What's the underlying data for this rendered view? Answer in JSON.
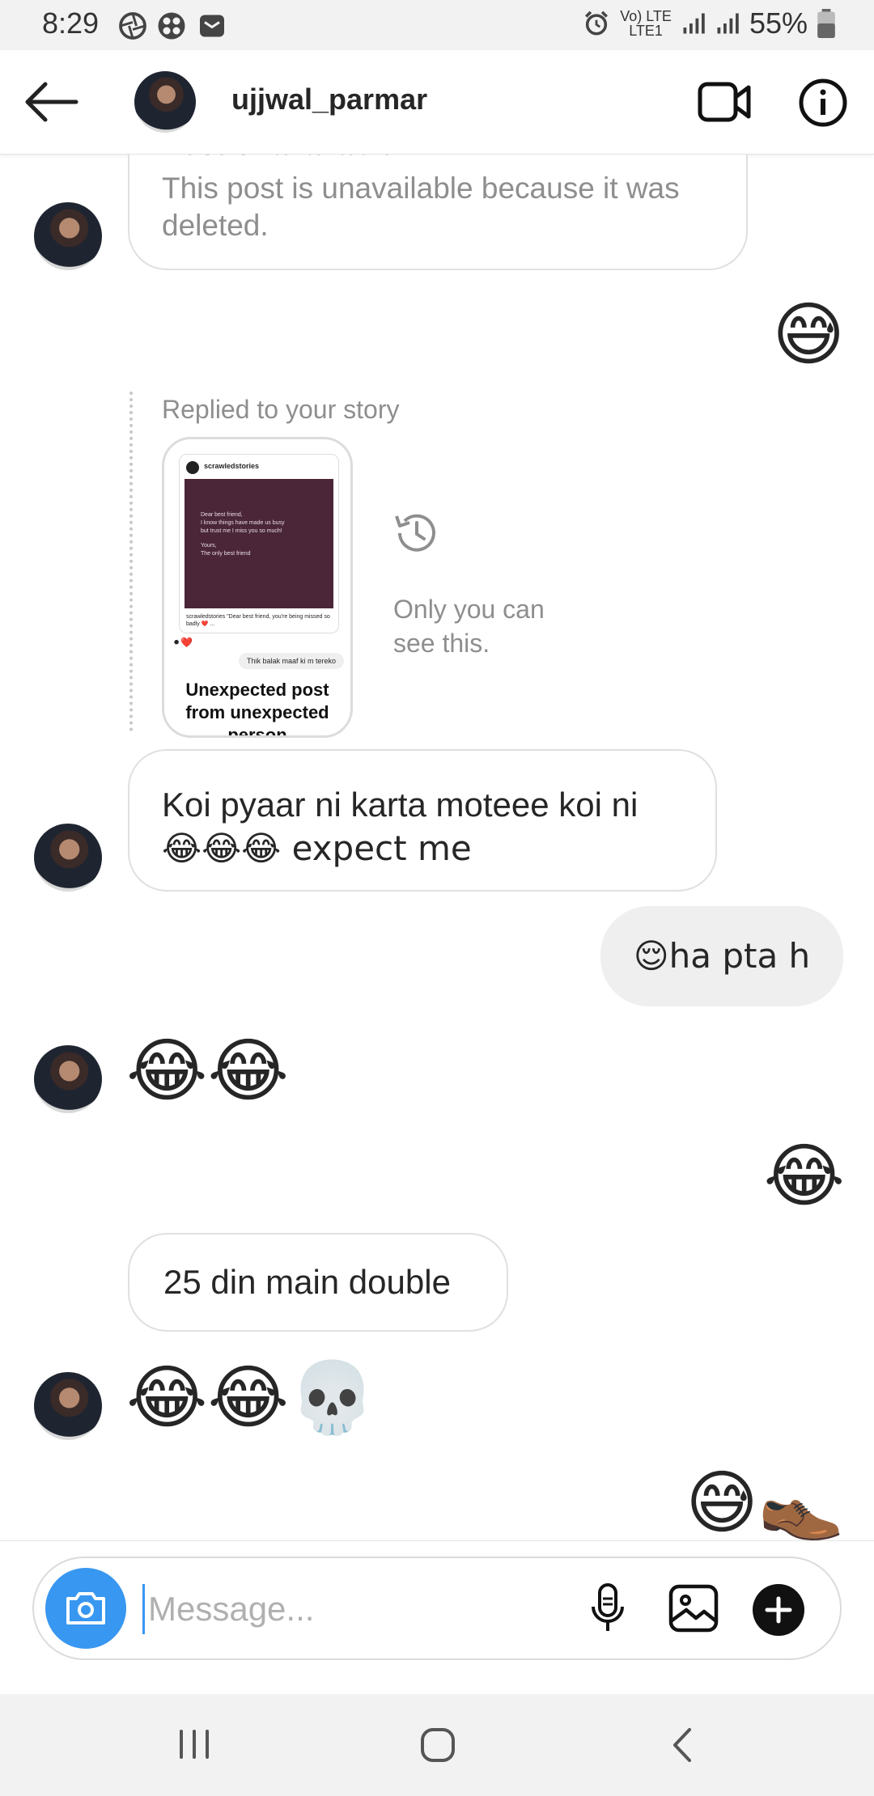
{
  "status_bar": {
    "time": "8:29",
    "network": "Vo) LTE",
    "network_sub": "LTE1",
    "battery": "55%"
  },
  "header": {
    "username": "ujjwal_parmar"
  },
  "messages": {
    "deleted_post_title": "Post Unavailable",
    "deleted_post_text": "This post is unavailable because it was deleted.",
    "out_emoji_1": "😅",
    "story_label": "Replied to your story",
    "story_card": {
      "account": "scrawledstories",
      "note_lines": [
        "Dear best friend,",
        "I know things have made us busy",
        "but trust me I miss you so much!",
        "",
        "Yours,",
        "The only best friend"
      ],
      "caption": "scrawledstories \"Dear best friend, you're being missed so badly ❤️ ...",
      "reply": "Thik balak maaf ki m tereko",
      "headline": "Unexpected post from unexpected person"
    },
    "only_you": "Only you can see this.",
    "in_text_1_line1": "Koi pyaar  ni karta moteee koi ni",
    "in_text_1_line2": "😂😂😂 expect me",
    "out_text_1": "😌ha pta h",
    "in_emoji_1": "😂😂",
    "out_emoji_2": "😂",
    "in_text_2": "25 din main double",
    "in_emoji_2": "😂😂💀",
    "out_emoji_3": "😅👞"
  },
  "composer": {
    "placeholder": "Message..."
  },
  "icons": {
    "back": "back-arrow-icon",
    "video": "video-camera-icon",
    "info": "info-icon",
    "camera": "camera-icon",
    "mic": "microphone-icon",
    "gallery": "gallery-icon",
    "plus": "plus-icon"
  },
  "colors": {
    "accent": "#3897f0",
    "bubble_out": "#efefef",
    "secondary_text": "#8e8e8e"
  }
}
